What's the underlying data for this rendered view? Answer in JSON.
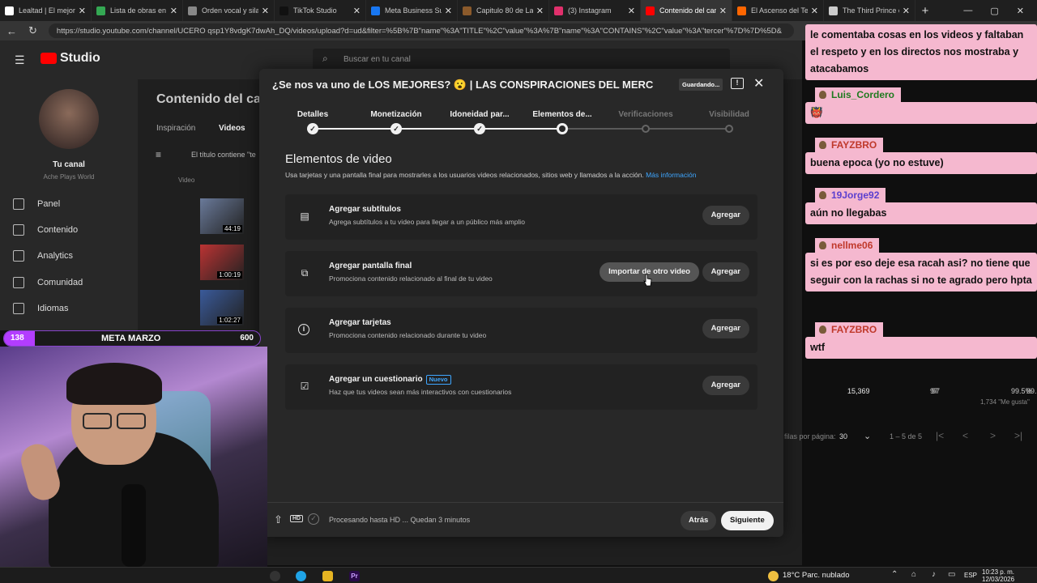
{
  "browser": {
    "tabs": [
      {
        "label": "Lealtad | El mejor sof",
        "color": "#ffffff"
      },
      {
        "label": "Lista de obras en seg",
        "color": "#34a853"
      },
      {
        "label": "Orden vocal y silaba",
        "color": "#888888"
      },
      {
        "label": "TikTok Studio",
        "color": "#111111"
      },
      {
        "label": "Meta Business Suite",
        "color": "#1877f2"
      },
      {
        "label": "Capitulo 80 de Las",
        "color": "#8b5a2b"
      },
      {
        "label": "(3) Instagram",
        "color": "#e1306c"
      },
      {
        "label": "Contenido del canal",
        "color": "#ff0000"
      },
      {
        "label": "El Ascenso del Terce",
        "color": "#ff6600"
      },
      {
        "label": "The Third Prince of t",
        "color": "#cccccc"
      }
    ],
    "url": "https://studio.youtube.com/channel/UCERO qsp1Y8vdgK7dwAh_DQ/videos/upload?d=ud&filter=%5B%7B\"name\"%3A\"TITLE\"%2C\"value\"%3A%7B\"name\"%3A\"CONTAINS\"%2C\"value\"%3A\"tercer\"%7D%7D%5D&"
  },
  "studio": {
    "logo": "Studio",
    "search_placeholder": "Buscar en tu canal",
    "channel_label": "Tu canal",
    "channel_name": "Ache Plays World",
    "page_title": "Contenido del can",
    "tabs": [
      "Inspiración",
      "Videos"
    ],
    "filter_text": "El título contiene \"te",
    "column_video": "Video",
    "nav": [
      "Panel",
      "Contenido",
      "Analytics",
      "Comunidad",
      "Idiomas"
    ],
    "durations": [
      "44:19",
      "1:00:19",
      "1:02:27"
    ],
    "bg_stats": {
      "views": "15,369",
      "comments": "97",
      "likes_pct": "99.5%",
      "likes_count": "1,734 \"Me gusta\""
    },
    "rows_per_page_label": "filas por página:",
    "rows_per_page": "30",
    "pagination": "1 – 5 de 5"
  },
  "modal": {
    "title": "¿Se nos va uno de LOS MEJORES? 😮 | LAS CONSPIRACIONES DEL MERC...",
    "saving": "Guardando...",
    "steps": [
      {
        "label": "Detalles",
        "state": "done"
      },
      {
        "label": "Monetización",
        "state": "done"
      },
      {
        "label": "Idoneidad par...",
        "state": "done"
      },
      {
        "label": "Elementos de...",
        "state": "current"
      },
      {
        "label": "Verificaciones",
        "state": "future"
      },
      {
        "label": "Visibilidad",
        "state": "future"
      }
    ],
    "section_title": "Elementos de video",
    "section_desc": "Usa tarjetas y una pantalla final para mostrarles a los usuarios videos relacionados, sitios web y llamados a la acción.",
    "more_info": "Más información",
    "cards": [
      {
        "title": "Agregar subtítulos",
        "sub": "Agrega subtítulos a tu video para llegar a un público más amplio",
        "icon": "subtitles-icon",
        "button": "Agregar"
      },
      {
        "title": "Agregar pantalla final",
        "sub": "Promociona contenido relacionado al final de tu video",
        "icon": "end-screen-icon",
        "button": "Agregar",
        "secondary_button": "Importar de otro video"
      },
      {
        "title": "Agregar tarjetas",
        "sub": "Promociona contenido relacionado durante tu video",
        "icon": "info-icon",
        "button": "Agregar"
      },
      {
        "title": "Agregar un cuestionario",
        "badge": "Nuevo",
        "sub": "Haz que tus videos sean más interactivos con cuestionarios",
        "icon": "checkbox-icon",
        "button": "Agregar"
      }
    ],
    "footer": {
      "processing": "Procesando hasta HD ... Quedan 3 minutos",
      "back": "Atrás",
      "next": "Siguiente"
    }
  },
  "stream": {
    "meta_left": "138",
    "meta_title": "META MARZO",
    "meta_right": "600",
    "chat": [
      {
        "name": "",
        "msg": "le comentaba cosas en los videos y faltaban el respeto y en los directos nos mostraba y atacabamos"
      },
      {
        "name": "Luis_Cordero",
        "msg": "👹"
      },
      {
        "name": "FAYZBRO",
        "msg": "buena epoca (yo no estuve)"
      },
      {
        "name": "19Jorge92",
        "msg": "aún no llegabas"
      },
      {
        "name": "nellme06",
        "msg": "si es por eso deje esa racah asi? no tiene que seguir con la rachas si no te agrado pero hpta"
      },
      {
        "name": "FAYZBRO",
        "msg": "wtf"
      }
    ]
  },
  "taskbar": {
    "weather": "18°C  Parc. nublado",
    "lang": "ESP",
    "time": "10:23 p. m.",
    "date": "12/03/2026"
  }
}
